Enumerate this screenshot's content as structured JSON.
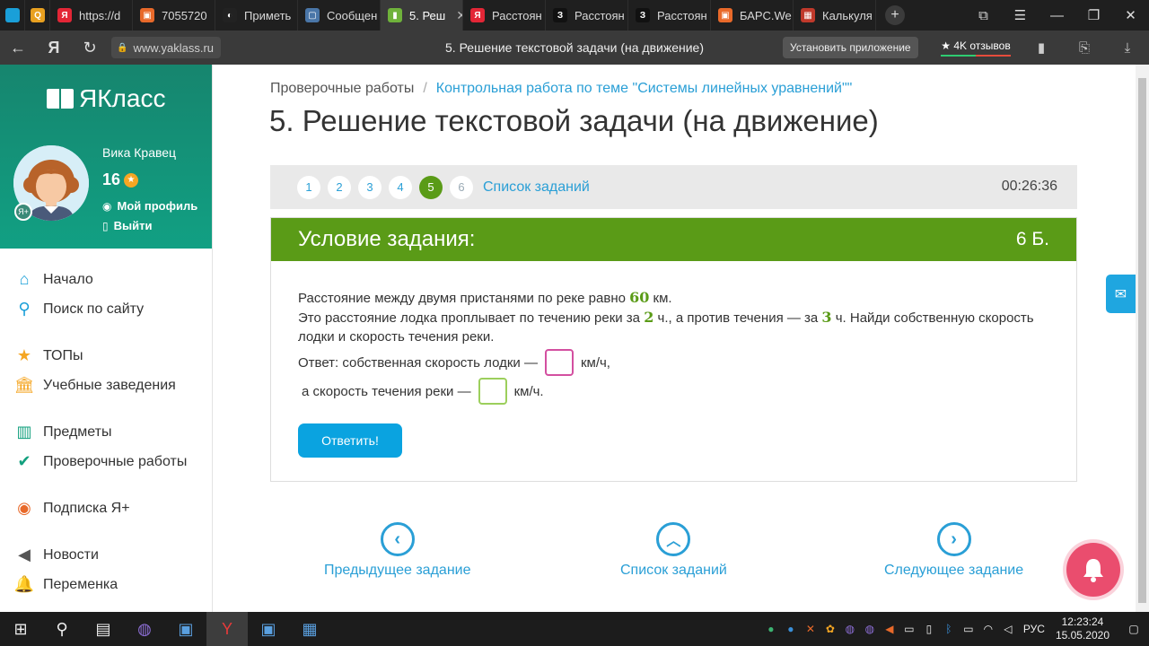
{
  "browser": {
    "tabs": [
      {
        "label": "https://d",
        "fav_color": "#e32636",
        "fav_text": "Я"
      },
      {
        "label": "7055720",
        "fav_color": "#e8692a",
        "fav_text": "▣"
      },
      {
        "label": "Приметь",
        "fav_color": "#222222",
        "fav_text": "◐"
      },
      {
        "label": "Сообщен",
        "fav_color": "#4a76a8",
        "fav_text": "▢"
      },
      {
        "label": "5. Реш",
        "fav_color": "#6fb23b",
        "fav_text": "▮",
        "active": true
      },
      {
        "label": "Расстоян",
        "fav_color": "#e32636",
        "fav_text": "Я"
      },
      {
        "label": "Расстоян",
        "fav_color": "#111111",
        "fav_text": "З"
      },
      {
        "label": "Расстоян",
        "fav_color": "#111111",
        "fav_text": "З"
      },
      {
        "label": "БАРС.We",
        "fav_color": "#e8692a",
        "fav_text": "▣"
      },
      {
        "label": "Калькуля",
        "fav_color": "#c0392b",
        "fav_text": "▦"
      }
    ],
    "url": "www.yaklass.ru",
    "page_title": "5. Решение текстовой задачи (на движение)",
    "install_label": "Установить приложение",
    "reviews_label": "★ 4K отзывов"
  },
  "sidebar": {
    "logo": "ЯКласс",
    "user_name": "Вика Кравец",
    "user_level": "16",
    "profile_label": "Мой профиль",
    "logout_label": "Выйти",
    "menu": [
      {
        "label": "Начало",
        "icon": "⌂",
        "color": "#1a9fd8"
      },
      {
        "label": "Поиск по сайту",
        "icon": "⚲",
        "color": "#1a9fd8"
      },
      {
        "gap": true
      },
      {
        "label": "ТОПы",
        "icon": "★",
        "color": "#f5a623"
      },
      {
        "label": "Учебные заведения",
        "icon": "🏛",
        "color": "#f5a623"
      },
      {
        "gap": true
      },
      {
        "label": "Предметы",
        "icon": "▥",
        "color": "#13a07e"
      },
      {
        "label": "Проверочные работы",
        "icon": "✔",
        "color": "#13a07e"
      },
      {
        "gap": true
      },
      {
        "label": "Подписка Я+",
        "icon": "◉",
        "color": "#e8692a"
      },
      {
        "gap": true
      },
      {
        "label": "Новости",
        "icon": "◀",
        "color": "#555555"
      },
      {
        "label": "Переменка",
        "icon": "🔔",
        "color": "#555555"
      }
    ]
  },
  "main": {
    "breadcrumb": {
      "root": "Проверочные работы",
      "separator": "/",
      "current": "Контрольная работа по теме \"Системы линейных уравнений\"\""
    },
    "title": "5. Решение текстовой задачи (на движение)",
    "task_numbers": [
      "1",
      "2",
      "3",
      "4",
      "5",
      "6"
    ],
    "active_task": "5",
    "task_list_label": "Список заданий",
    "timer": "00:26:36",
    "card": {
      "heading": "Условие задания:",
      "points": "6 Б.",
      "line1_pre": "Расстояние между двумя пристанями по реке равно ",
      "distance": "60",
      "line1_post": " км.",
      "line2_pre": "Это расстояние лодка проплывает по течению реки за ",
      "time_down": "2",
      "line2_mid": " ч., а против течения — за ",
      "time_up": "3",
      "line2_post": " ч. Найди собственную скорость лодки и скорость течения реки.",
      "answer1_pre": "Ответ: собственная скорость лодки —",
      "answer1_unit": "км/ч,",
      "answer2_pre": "а скорость течения реки —",
      "answer2_unit": "км/ч.",
      "submit_label": "Ответить!"
    },
    "bottom_nav": {
      "prev": "Предыдущее задание",
      "list": "Список заданий",
      "next": "Следующее задание"
    }
  },
  "taskbar": {
    "lang": "РУС",
    "time": "12:23:24",
    "date": "15.05.2020"
  },
  "colors": {
    "brand_green": "#5a9b17",
    "link_blue": "#2a9fd6",
    "button_blue": "#0aa3e0",
    "sidebar_teal": "#13a07e"
  }
}
